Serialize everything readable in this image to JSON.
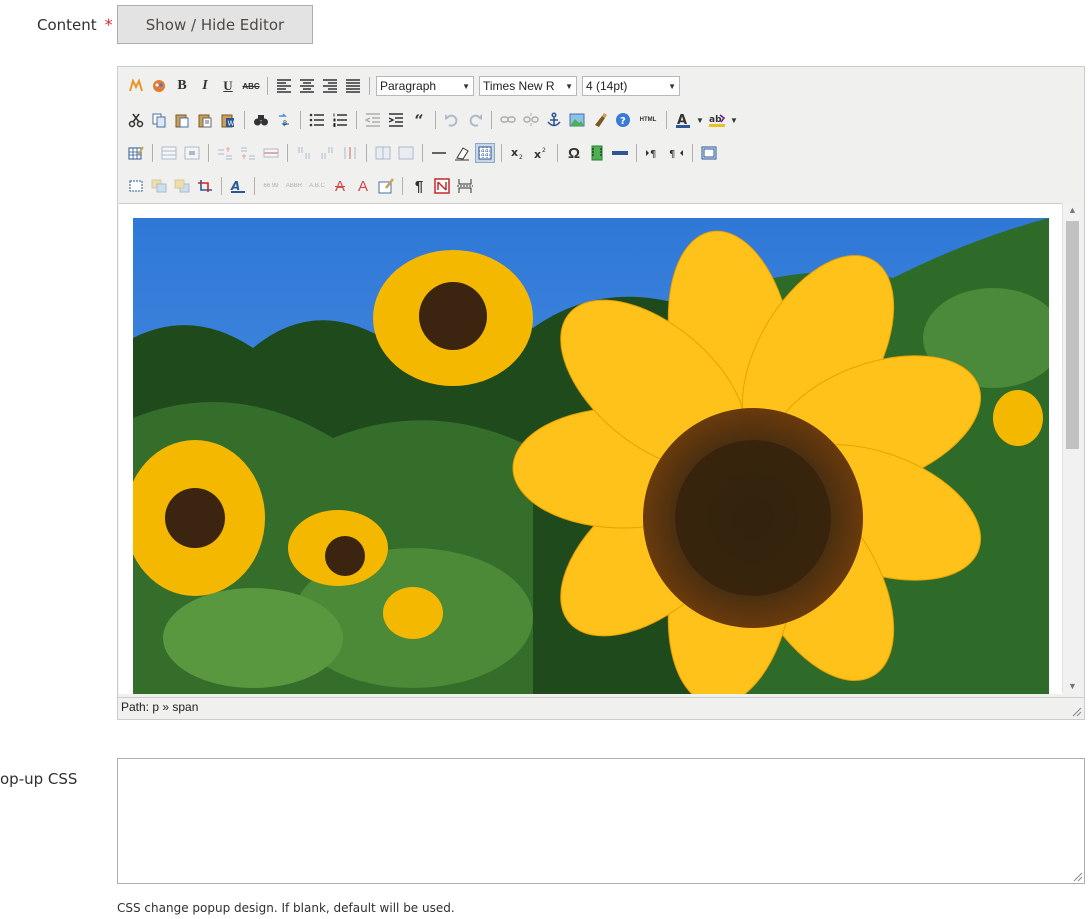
{
  "content_field": {
    "label": "Content",
    "required_mark": "*",
    "toggle_button": "Show / Hide Editor"
  },
  "editor": {
    "block_format": "Paragraph",
    "font_family": "Times New R",
    "font_size": "4 (14pt)",
    "toolbar_text": {
      "bold": "B",
      "italic": "I",
      "underline": "U",
      "strike": "ABC",
      "html": "HTML",
      "pilcrow": "¶",
      "omega": "Ω"
    },
    "image_description": "Sunflowers against a blue sky",
    "status_path": "Path: p » span"
  },
  "popup_css_field": {
    "label": "op-up CSS",
    "value": "",
    "note": "CSS change popup design. If blank, default will be used."
  }
}
